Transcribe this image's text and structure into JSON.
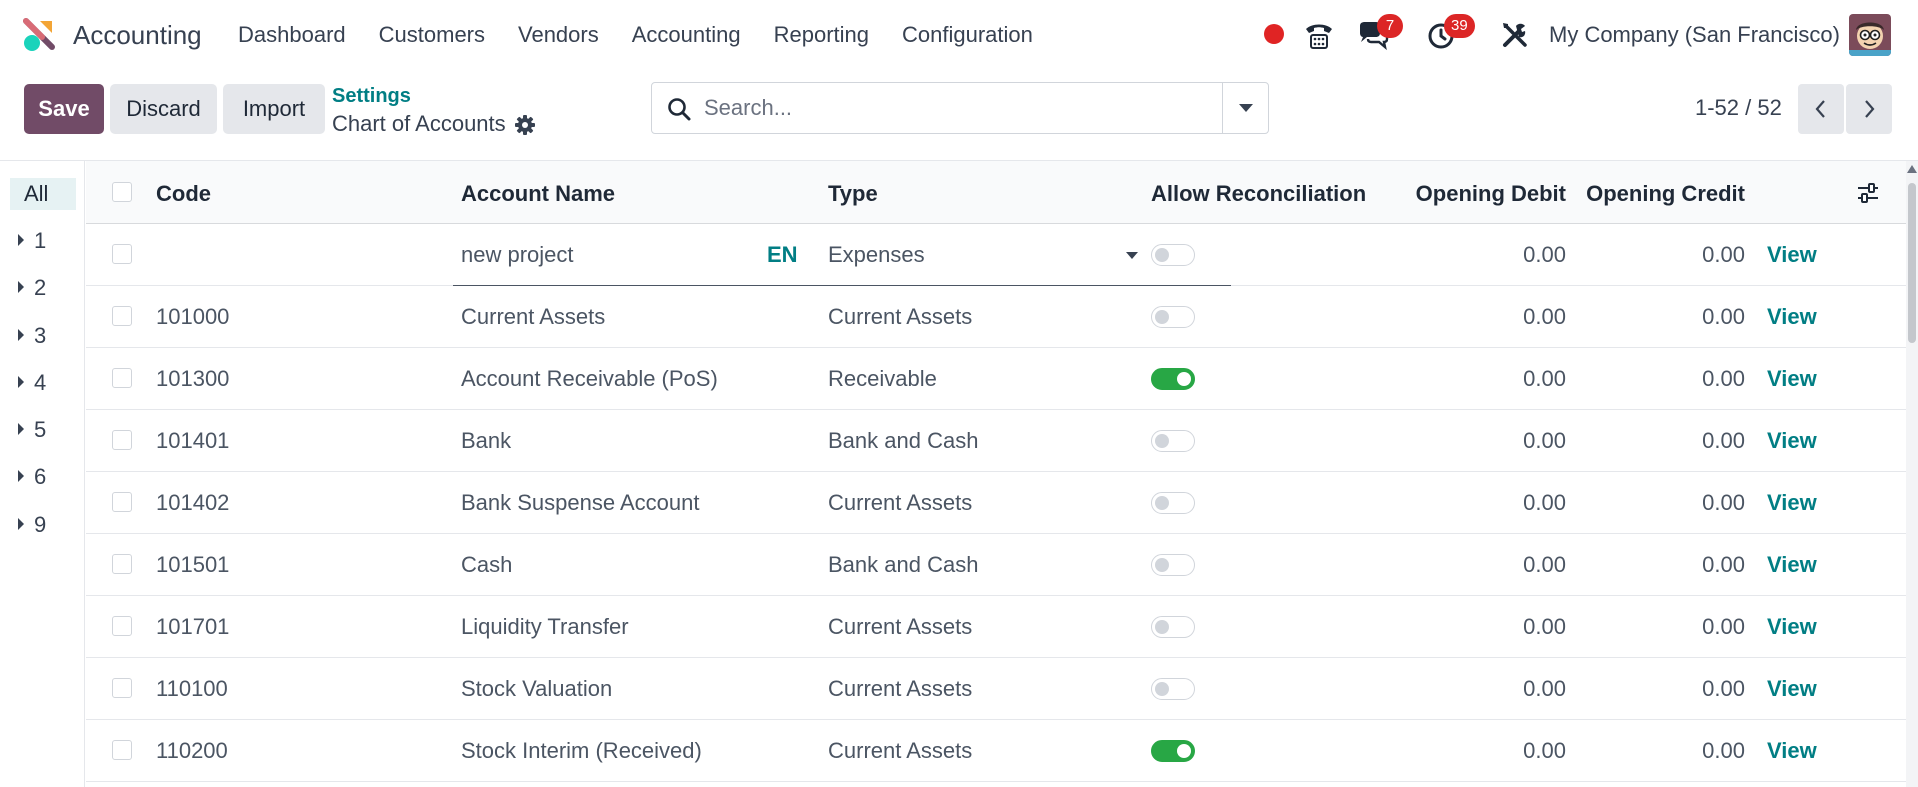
{
  "navbar": {
    "app_name": "Accounting",
    "menu": [
      "Dashboard",
      "Customers",
      "Vendors",
      "Accounting",
      "Reporting",
      "Configuration"
    ],
    "messages_badge": "7",
    "activities_badge": "39",
    "company": "My Company (San Francisco)",
    "icons": [
      "apps-logo-icon",
      "recording-dot-icon",
      "phone-icon",
      "chat-icon",
      "clock-icon",
      "tools-icon",
      "user-avatar"
    ]
  },
  "control_panel": {
    "save_label": "Save",
    "discard_label": "Discard",
    "import_label": "Import",
    "breadcrumb_parent": "Settings",
    "breadcrumb_current": "Chart of Accounts",
    "search_placeholder": "Search...",
    "pager": "1-52 / 52"
  },
  "groups": {
    "all_label": "All",
    "items": [
      "1",
      "2",
      "3",
      "4",
      "5",
      "6",
      "9"
    ]
  },
  "table": {
    "columns": {
      "code": "Code",
      "name": "Account Name",
      "type": "Type",
      "reconcile": "Allow Reconciliation",
      "debit": "Opening Debit",
      "credit": "Opening Credit"
    },
    "new_row": {
      "code": "",
      "name": "new project",
      "lang": "EN",
      "type": "Expenses",
      "reconcile": false,
      "debit": "0.00",
      "credit": "0.00",
      "action": "View"
    },
    "rows": [
      {
        "code": "101000",
        "name": "Current Assets",
        "type": "Current Assets",
        "reconcile": false,
        "debit": "0.00",
        "credit": "0.00",
        "action": "View"
      },
      {
        "code": "101300",
        "name": "Account Receivable (PoS)",
        "type": "Receivable",
        "reconcile": true,
        "debit": "0.00",
        "credit": "0.00",
        "action": "View"
      },
      {
        "code": "101401",
        "name": "Bank",
        "type": "Bank and Cash",
        "reconcile": false,
        "debit": "0.00",
        "credit": "0.00",
        "action": "View"
      },
      {
        "code": "101402",
        "name": "Bank Suspense Account",
        "type": "Current Assets",
        "reconcile": false,
        "debit": "0.00",
        "credit": "0.00",
        "action": "View"
      },
      {
        "code": "101501",
        "name": "Cash",
        "type": "Bank and Cash",
        "reconcile": false,
        "debit": "0.00",
        "credit": "0.00",
        "action": "View"
      },
      {
        "code": "101701",
        "name": "Liquidity Transfer",
        "type": "Current Assets",
        "reconcile": false,
        "debit": "0.00",
        "credit": "0.00",
        "action": "View"
      },
      {
        "code": "110100",
        "name": "Stock Valuation",
        "type": "Current Assets",
        "reconcile": false,
        "debit": "0.00",
        "credit": "0.00",
        "action": "View"
      },
      {
        "code": "110200",
        "name": "Stock Interim (Received)",
        "type": "Current Assets",
        "reconcile": true,
        "debit": "0.00",
        "credit": "0.00",
        "action": "View"
      }
    ]
  },
  "colors": {
    "primary": "#714b67",
    "link": "#017e84",
    "toggle_on": "#28a745",
    "badge": "#dc2626"
  }
}
